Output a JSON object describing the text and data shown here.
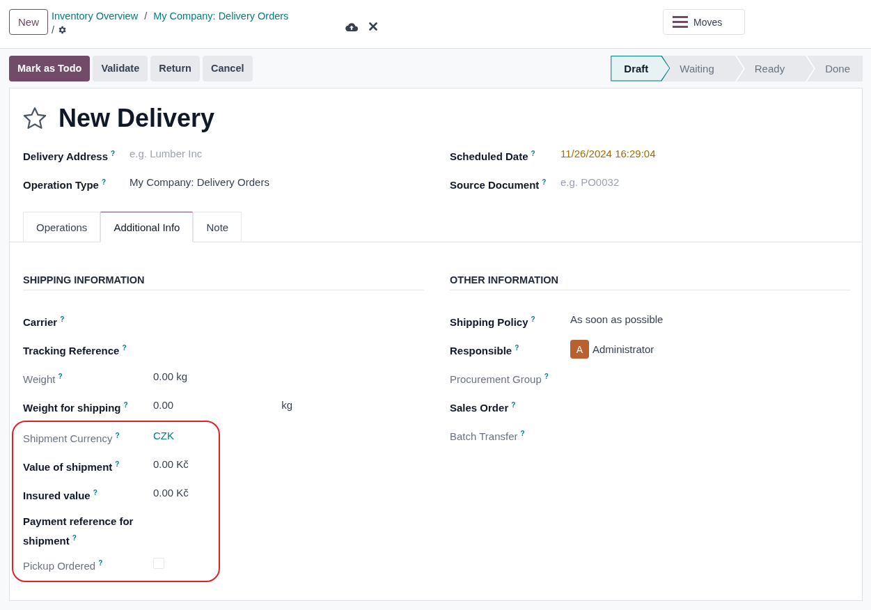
{
  "header": {
    "new_button": "New",
    "breadcrumbs": [
      "Inventory Overview",
      "My Company: Delivery Orders"
    ],
    "separators": [
      "/",
      "/"
    ],
    "moves_button": "Moves"
  },
  "actions": [
    {
      "label": "Mark as Todo",
      "primary": true
    },
    {
      "label": "Validate",
      "primary": false
    },
    {
      "label": "Return",
      "primary": false
    },
    {
      "label": "Cancel",
      "primary": false
    }
  ],
  "status_steps": [
    {
      "label": "Draft",
      "selected": true
    },
    {
      "label": "Waiting",
      "selected": false
    },
    {
      "label": "Ready",
      "selected": false
    },
    {
      "label": "Done",
      "selected": false
    }
  ],
  "record": {
    "starred": false,
    "title": "New Delivery"
  },
  "top_fields": {
    "left": [
      {
        "label": "Delivery Address",
        "help": "?",
        "readonly": false,
        "kind": "text",
        "placeholder": "e.g. Lumber Inc"
      },
      {
        "label": "Operation Type",
        "help": "?",
        "readonly": false,
        "kind": "text",
        "value": "My Company: Delivery Orders"
      }
    ],
    "right": [
      {
        "label": "Scheduled Date",
        "help": "?",
        "readonly": false,
        "kind": "date",
        "value": "11/26/2024 16:29:04"
      },
      {
        "label": "Source Document",
        "help": "?",
        "readonly": false,
        "kind": "text",
        "placeholder": "e.g. PO0032"
      }
    ]
  },
  "tabs": [
    {
      "label": "Operations",
      "selected": false
    },
    {
      "label": "Additional Info",
      "selected": true
    },
    {
      "label": "Note",
      "selected": false
    }
  ],
  "shipping": {
    "title": "SHIPPING INFORMATION",
    "fields": [
      {
        "label": "Carrier",
        "help": "?",
        "readonly": false,
        "kind": "empty"
      },
      {
        "label": "Tracking Reference",
        "help": "?",
        "readonly": false,
        "kind": "empty"
      },
      {
        "label": "Weight",
        "help": "?",
        "readonly": true,
        "kind": "text",
        "value": "0.00 kg"
      },
      {
        "label": "Weight for shipping",
        "help": "?",
        "readonly": false,
        "kind": "unit",
        "value": "0.00",
        "unit": "kg"
      }
    ],
    "highlighted_fields": [
      {
        "label": "Shipment Currency",
        "help": "?",
        "readonly": true,
        "kind": "link",
        "value": "CZK"
      },
      {
        "label": "Value of shipment",
        "help": "?",
        "readonly": false,
        "kind": "text",
        "value": "0.00 Kč"
      },
      {
        "label": "Insured value",
        "help": "?",
        "readonly": false,
        "kind": "text",
        "value": "0.00 Kč"
      },
      {
        "label": "Payment reference for shipment",
        "help": "?",
        "readonly": false,
        "kind": "empty"
      },
      {
        "label": "Pickup Ordered",
        "help": "?",
        "readonly": true,
        "kind": "checkbox",
        "checked": false
      }
    ]
  },
  "other": {
    "title": "OTHER INFORMATION",
    "fields": [
      {
        "label": "Shipping Policy",
        "help": "?",
        "readonly": false,
        "kind": "text",
        "value": "As soon as possible"
      },
      {
        "label": "Responsible",
        "help": "?",
        "readonly": false,
        "kind": "avatar",
        "initial": "A",
        "value": "Administrator"
      },
      {
        "label": "Procurement Group",
        "help": "?",
        "readonly": true,
        "kind": "empty"
      },
      {
        "label": "Sales Order",
        "help": "?",
        "readonly": false,
        "kind": "empty"
      },
      {
        "label": "Batch Transfer",
        "help": "?",
        "readonly": true,
        "kind": "empty"
      }
    ]
  }
}
